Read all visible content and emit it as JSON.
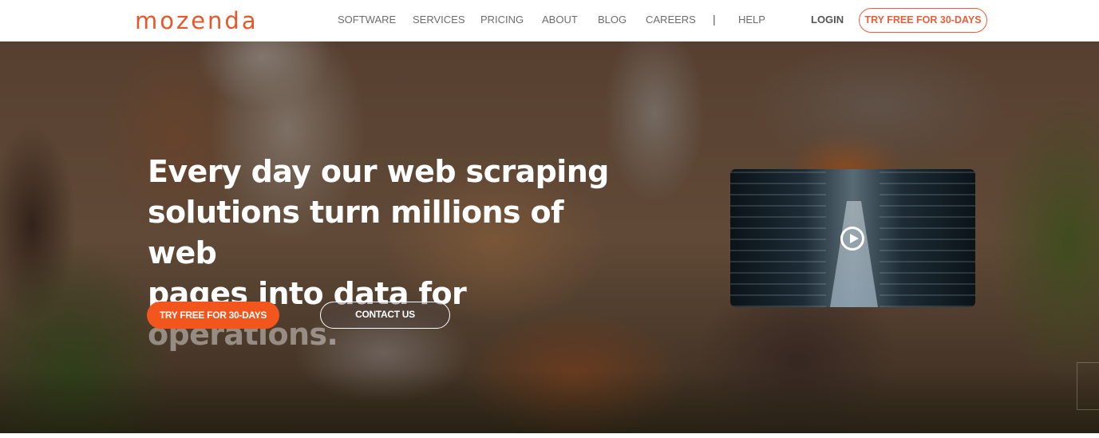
{
  "brand": {
    "logo_text": "mozenda",
    "accent_color": "#e8572a",
    "primary_button_color": "#f2561d"
  },
  "header": {
    "nav_items": [
      {
        "label": "SOFTWARE"
      },
      {
        "label": "SERVICES"
      },
      {
        "label": "PRICING"
      },
      {
        "label": "ABOUT"
      },
      {
        "label": "BLOG"
      },
      {
        "label": "CAREERS"
      },
      {
        "label": "HELP"
      }
    ],
    "separator": "|",
    "login_label": "LOGIN",
    "cta_label": "TRY FREE FOR 30-DAYS"
  },
  "hero": {
    "headline_lines": [
      "Every day our web scraping",
      "solutions turn millions of web",
      "pages into data for "
    ],
    "headline_animated_word": "operations.",
    "primary_cta_label": "TRY FREE FOR 30-DAYS",
    "secondary_cta_label": "CONTACT US",
    "video": {
      "thumbnail": "data-center-server-corridor",
      "play_icon": "play-circle-icon"
    }
  }
}
